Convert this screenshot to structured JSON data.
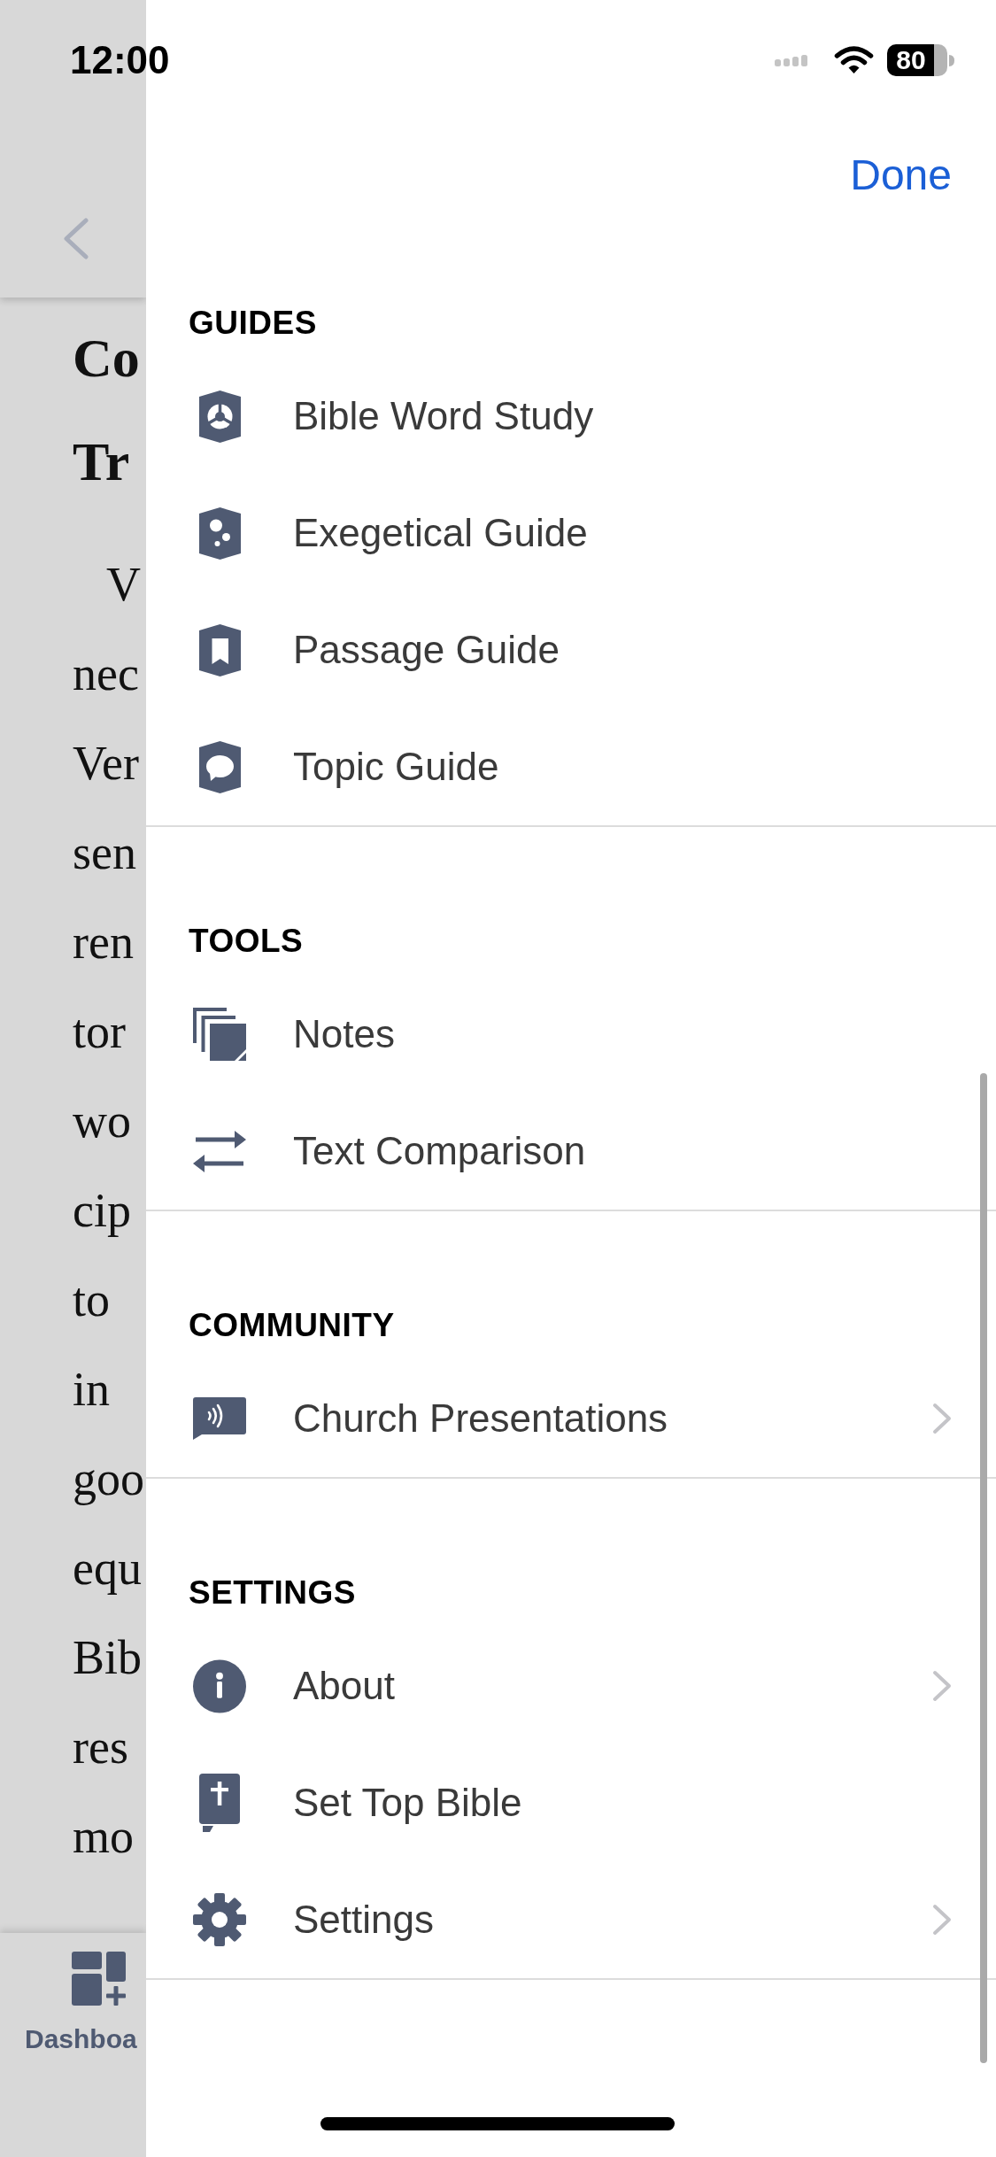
{
  "status_bar": {
    "time": "12:00",
    "battery": "80"
  },
  "background_page": {
    "heading_lines": [
      "Co",
      "Tr"
    ],
    "body_lines": [
      "V",
      "nec",
      "Ver",
      "sen",
      "ren",
      "tor",
      "wo",
      "cip",
      "to",
      "in",
      "goo",
      "equ",
      "Bib",
      "res",
      "mo"
    ],
    "tab_bar": {
      "tabs": [
        {
          "label": "Dashboa"
        }
      ]
    }
  },
  "sheet": {
    "done_button": "Done",
    "sections": [
      {
        "title": "GUIDES",
        "items": [
          {
            "label": "Bible Word Study",
            "disclosure": false
          },
          {
            "label": "Exegetical Guide",
            "disclosure": false
          },
          {
            "label": "Passage Guide",
            "disclosure": false
          },
          {
            "label": "Topic Guide",
            "disclosure": false
          }
        ]
      },
      {
        "title": "TOOLS",
        "items": [
          {
            "label": "Notes",
            "disclosure": false
          },
          {
            "label": "Text Comparison",
            "disclosure": false
          }
        ]
      },
      {
        "title": "COMMUNITY",
        "items": [
          {
            "label": "Church Presentations",
            "disclosure": true
          }
        ]
      },
      {
        "title": "SETTINGS",
        "items": [
          {
            "label": "About",
            "disclosure": true
          },
          {
            "label": "Set Top Bible",
            "disclosure": false
          },
          {
            "label": "Settings",
            "disclosure": true
          }
        ]
      }
    ]
  }
}
